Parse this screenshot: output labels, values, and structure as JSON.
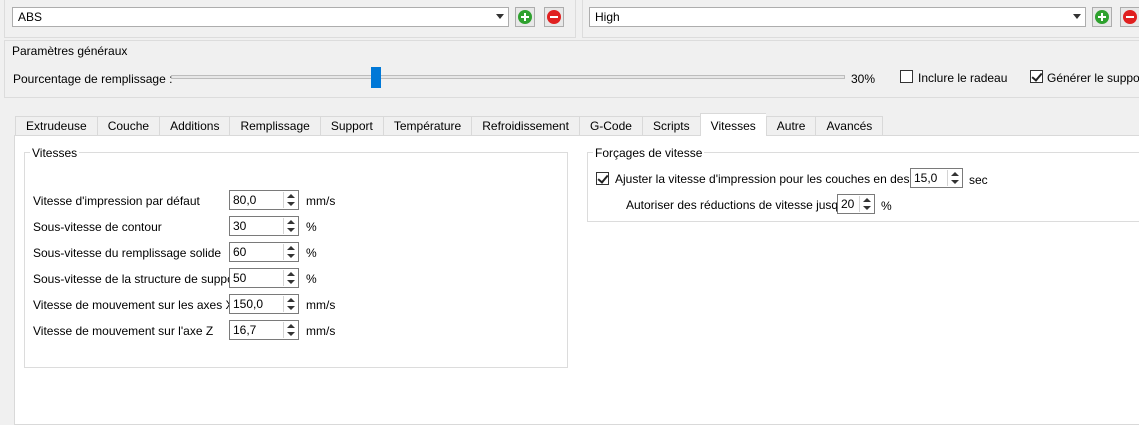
{
  "profiles": {
    "material": {
      "value": "ABS"
    },
    "quality": {
      "value": "High"
    }
  },
  "general": {
    "legend": "Paramètres généraux",
    "fill_label": "Pourcentage de remplissage :",
    "fill_value_text": "30%",
    "fill_percent": 30,
    "include_raft_label": "Inclure le radeau",
    "include_raft_checked": false,
    "generate_support_label": "Générer le support",
    "generate_support_checked": true
  },
  "tabs": [
    "Extrudeuse",
    "Couche",
    "Additions",
    "Remplissage",
    "Support",
    "Température",
    "Refroidissement",
    "G-Code",
    "Scripts",
    "Vitesses",
    "Autre",
    "Avancés"
  ],
  "active_tab": "Vitesses",
  "speeds": {
    "legend": "Vitesses",
    "rows": [
      {
        "label": "Vitesse d'impression par défaut",
        "value": "80,0",
        "unit": "mm/s"
      },
      {
        "label": "Sous-vitesse de contour",
        "value": "30",
        "unit": "%"
      },
      {
        "label": "Sous-vitesse du remplissage solide",
        "value": "60",
        "unit": "%"
      },
      {
        "label": "Sous-vitesse de la structure de support",
        "value": "50",
        "unit": "%"
      },
      {
        "label": "Vitesse de mouvement sur les axes X/Y",
        "value": "150,0",
        "unit": "mm/s"
      },
      {
        "label": "Vitesse de mouvement sur l'axe Z",
        "value": "16,7",
        "unit": "mm/s"
      }
    ]
  },
  "overrides": {
    "legend": "Forçages de vitesse",
    "adjust_label": "Ajuster la vitesse d'impression pour les couches en dessous",
    "adjust_checked": true,
    "adjust_value": "15,0",
    "adjust_unit": "sec",
    "reduce_label": "Autoriser des réductions de vitesse jusqu'à",
    "reduce_value": "20",
    "reduce_unit": "%"
  }
}
